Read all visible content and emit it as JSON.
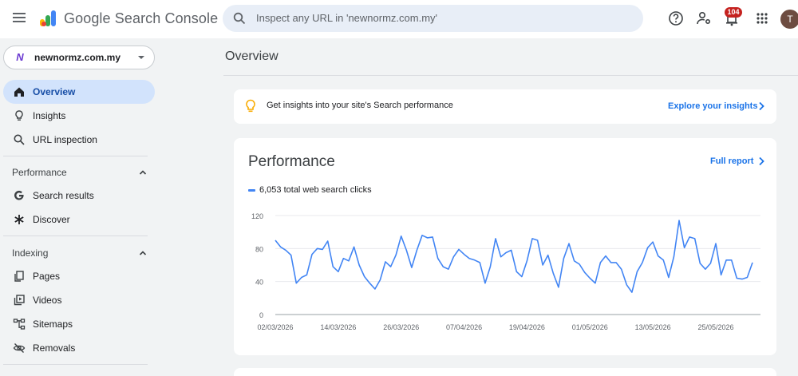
{
  "header": {
    "brand": "Google Search Console",
    "search_placeholder": "Inspect any URL in 'newnormz.com.my'",
    "notification_count": "104",
    "avatar_initial": "T"
  },
  "property": {
    "name": "newnormz.com.my",
    "favicon_letter": "N"
  },
  "sidebar": {
    "overview": "Overview",
    "insights": "Insights",
    "url_inspection": "URL inspection",
    "performance_section": "Performance",
    "search_results": "Search results",
    "discover": "Discover",
    "indexing_section": "Indexing",
    "pages": "Pages",
    "videos": "Videos",
    "sitemaps": "Sitemaps",
    "removals": "Removals"
  },
  "main": {
    "title": "Overview",
    "insight_text": "Get insights into your site's Search performance",
    "insight_link": "Explore your insights",
    "performance_title": "Performance",
    "full_report": "Full report"
  },
  "colors": {
    "accent": "#1a73e8",
    "line": "#4285f4",
    "active_nav": "#d2e3fc",
    "badge": "#c5221f"
  },
  "chart_data": {
    "type": "line",
    "title": "",
    "legend": "6,053 total web search clicks",
    "xlabel": "",
    "ylabel": "",
    "ylim": [
      0,
      120
    ],
    "yticks": [
      "120",
      "80",
      "40",
      "0"
    ],
    "xtick_labels": [
      "02/03/2026",
      "14/03/2026",
      "26/03/2026",
      "07/04/2026",
      "19/04/2026",
      "01/05/2026",
      "13/05/2026",
      "25/05/2026"
    ],
    "series": [
      {
        "values": [
          90,
          82,
          78,
          72,
          38,
          45,
          48,
          73,
          80,
          79,
          89,
          58,
          52,
          68,
          65,
          82,
          60,
          46,
          38,
          31,
          42,
          64,
          58,
          72,
          95,
          78,
          57,
          78,
          96,
          93,
          94,
          68,
          58,
          55,
          70,
          79,
          73,
          68,
          66,
          63,
          38,
          58,
          92,
          70,
          75,
          78,
          52,
          46,
          65,
          92,
          90,
          60,
          72,
          50,
          33,
          68,
          86,
          65,
          61,
          51,
          44,
          38,
          63,
          71,
          63,
          63,
          55,
          36,
          27,
          52,
          63,
          81,
          88,
          71,
          66,
          45,
          70,
          114,
          81,
          94,
          92,
          62,
          55,
          62,
          86,
          48,
          66,
          66,
          44,
          43,
          45,
          63
        ]
      }
    ]
  }
}
